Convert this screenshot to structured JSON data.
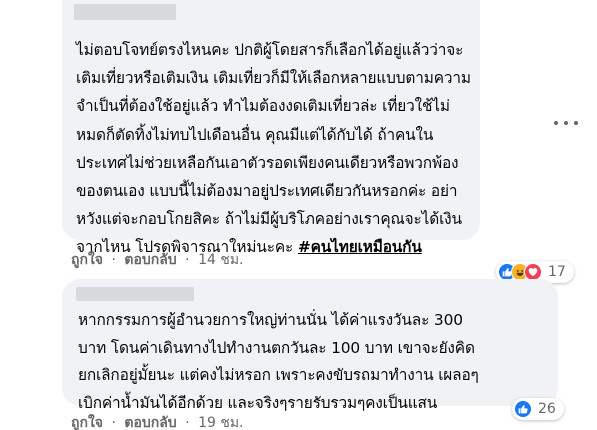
{
  "comments": [
    {
      "lines": [
        "ไม่ตอบโจทย์ตรงไหนคะ ปกติผู้โดยสารก็เลือกได้อยู่แล้วว่าจะ",
        "เติมเที่ยวหรือเติมเงิน เติมเที่ยวก็มีให้เลือกหลายแบบตามความ",
        "จำเป็นที่ต้องใช้อยู่แล้ว ทำไมต้องงดเติมเที่ยวล่ะ เที่ยวใช้ไม่",
        "หมดก็ตัดทิ้งไม่ทบไปเดือนอื่น คุณมีแต่ได้กับได้ ถ้าคนใน",
        "ประเทศไม่ช่วยเหลือกันเอาตัวรอดเพียงคนเดียวหรือพวกพ้อง",
        "ของตนเอง แบบนี้ไม่ต้องมาอยู่ประเทศเดียวกันหรอกค่ะ อย่า",
        "หวังแต่จะกอบโกยสิคะ ถ้าไม่มีผู้บริโภคอย่างเราคุณจะได้เงิน",
        "จากไหน โปรดพิจารณาใหม่นะคะ "
      ],
      "hashtag": "#คนไทยเหมือนกัน",
      "like_label": "ถูกใจ",
      "reply_label": "ตอบกลับ",
      "separator": "·",
      "time": "14 ชม.",
      "reaction_count": "17",
      "reaction_icons": [
        "like-icon",
        "haha-icon",
        "love-icon"
      ]
    },
    {
      "lines": [
        "หากกรรมการผู้อำนวยการใหญ่ท่านนั่น ได้ค่าแรงวันละ 300",
        "บาท โดนค่าเดินทางไปทำงานตกวันละ 100 บาท เขาจะยังคิด",
        "ยกเลิกอยู่มั้ยนะ แต่คงไม่หรอก เพราะคงขับรถมาทำงาน เผลอๆ",
        "เบิกค่าน้ำมันได้อีกด้วย และจริงๆรายรับรวมๆคงเป็นแสน"
      ],
      "like_label": "ถูกใจ",
      "reply_label": "ตอบกลับ",
      "separator": "·",
      "time": "19 ชม.",
      "reaction_count": "26",
      "reaction_icons": [
        "like-icon"
      ]
    }
  ],
  "colors": {
    "bubble": "#f0f2f5",
    "secondary_text": "#65676b",
    "like_blue": "#1877f2",
    "love_red": "#f33e58",
    "haha_yellow": "#f7b125"
  },
  "more_options_icon": "more-options-icon"
}
